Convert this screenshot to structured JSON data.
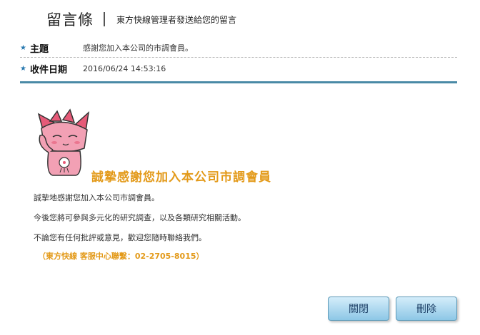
{
  "header": {
    "title": "留言條",
    "subtitle": "東方快線管理者發送給您的留言"
  },
  "meta": {
    "subject_label": "主題",
    "subject_value": "感謝您加入本公司的市調會員。",
    "date_label": "收件日期",
    "date_value": "2016/06/24 14:53:16"
  },
  "message": {
    "headline": "誠摯感謝您加入本公司市調會員",
    "paragraphs": [
      "誠摯地感謝您加入本公司市調會員。",
      "今後您將可參與多元化的研究調查，以及各類研究相關活動。",
      "不論您有任何批評或意見，歡迎您隨時聯絡我們。"
    ],
    "contact": "（東方快線 客服中心聯繫：02-2705-8015）"
  },
  "buttons": {
    "close": "關閉",
    "delete": "刪除"
  },
  "colors": {
    "accent_orange": "#e39a1a",
    "rule_blue": "#4a8aa6",
    "star_blue": "#2a7ab0",
    "mascot_pink": "#f2a0b4"
  }
}
